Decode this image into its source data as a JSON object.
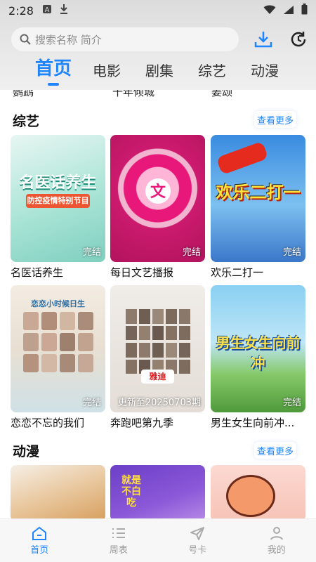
{
  "status_bar": {
    "time": "2:28"
  },
  "search": {
    "placeholder": "搜索名称 简介"
  },
  "tabs": [
    {
      "label": "首页",
      "active": true
    },
    {
      "label": "电影",
      "active": false
    },
    {
      "label": "剧集",
      "active": false
    },
    {
      "label": "综艺",
      "active": false
    },
    {
      "label": "动漫",
      "active": false
    }
  ],
  "prev_row_titles": [
    "鹦鹉",
    "十年倾城",
    "姜颂"
  ],
  "sections": {
    "variety": {
      "title": "综艺",
      "more_label": "查看更多",
      "items": [
        {
          "title": "名医话养生",
          "badge": "完结",
          "poster_text": "名医话养生",
          "poster_sub": "防控疫情特别节目"
        },
        {
          "title": "每日文艺播报",
          "badge": "完结"
        },
        {
          "title": "欢乐二打一",
          "badge": "完结",
          "poster_text": "欢乐二打一"
        },
        {
          "title": "恋恋不忘的我们",
          "badge": "完结",
          "poster_text": "恋恋小时候日生"
        },
        {
          "title": "奔跑吧第九季",
          "badge": "更新至20250703期",
          "poster_text": "雅迪"
        },
        {
          "title": "男生女生向前冲...",
          "badge": "完结",
          "poster_text": "男生女生向前冲"
        }
      ]
    },
    "anime": {
      "title": "动漫",
      "more_label": "查看更多",
      "items": [
        {
          "poster_text": ""
        },
        {
          "poster_text": "就是不白吃"
        },
        {
          "poster_text": ""
        }
      ]
    }
  },
  "bottom_nav": [
    {
      "label": "首页",
      "active": true
    },
    {
      "label": "周表",
      "active": false
    },
    {
      "label": "号卡",
      "active": false
    },
    {
      "label": "我的",
      "active": false
    }
  ],
  "colors": {
    "accent": "#1e84ff",
    "header_bg": "#e4e4e4"
  }
}
